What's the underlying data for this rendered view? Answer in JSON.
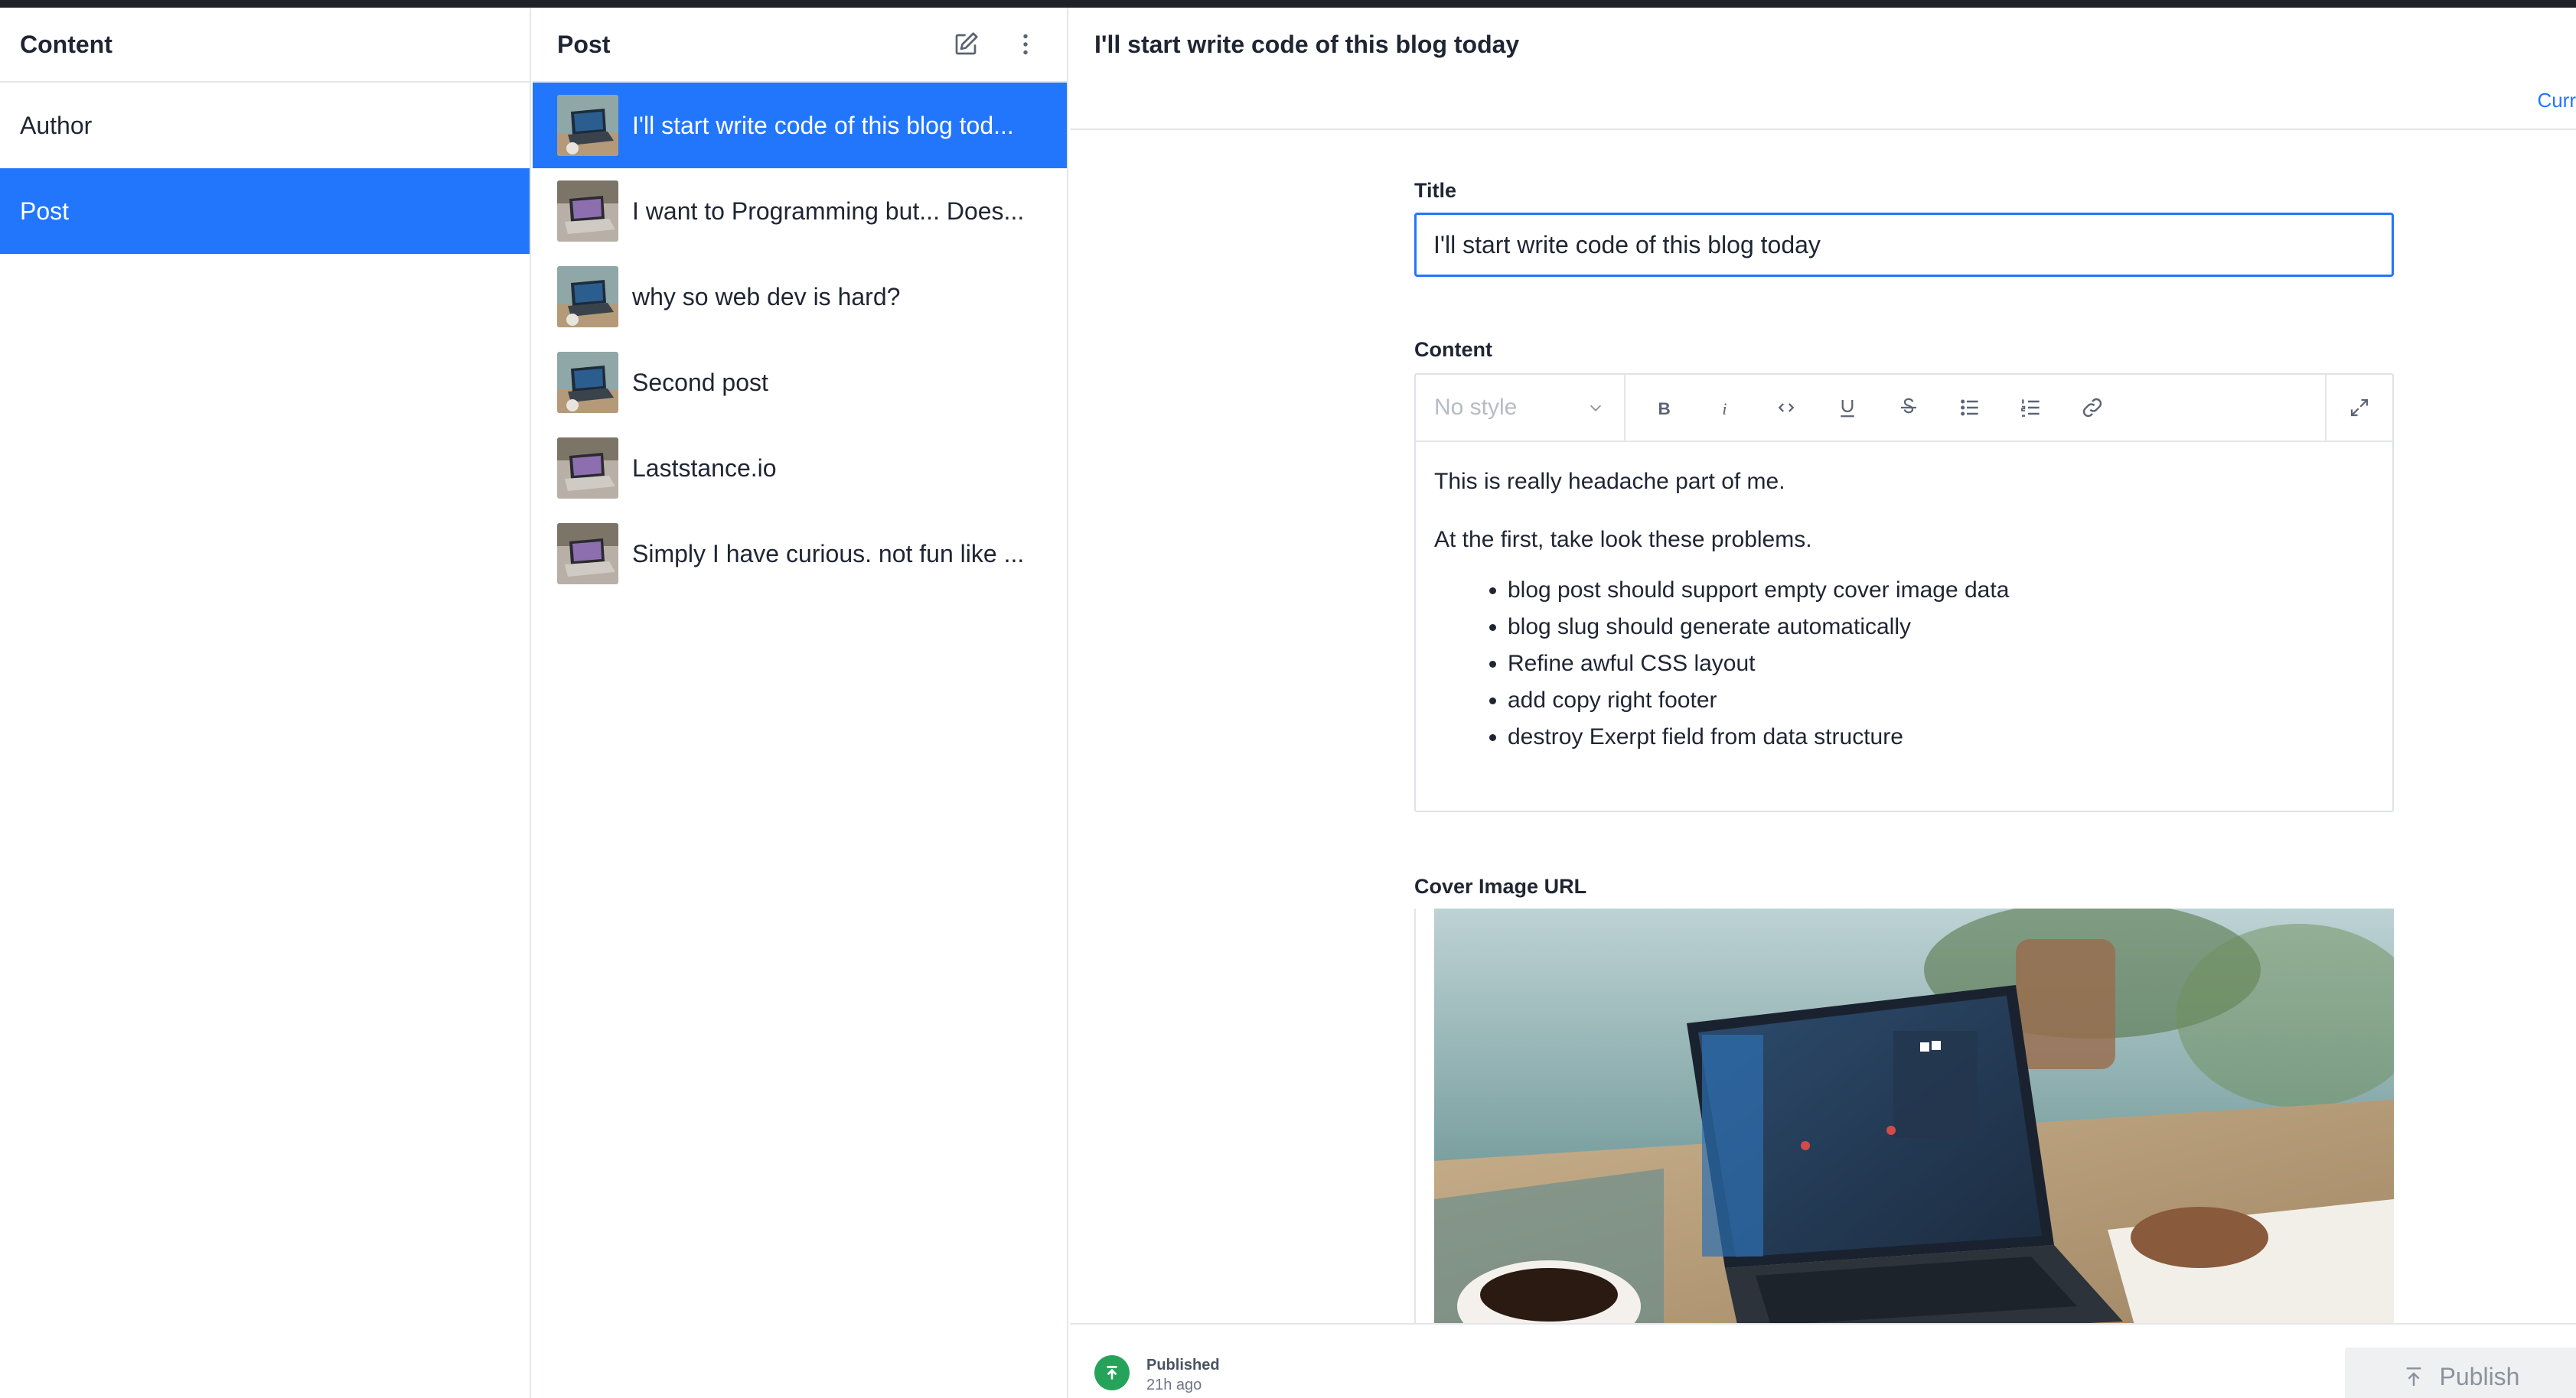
{
  "colors": {
    "accent": "#2276fc",
    "published": "#26a35a"
  },
  "content_pane": {
    "title": "Content",
    "items": [
      {
        "label": "Author",
        "selected": false
      },
      {
        "label": "Post",
        "selected": true
      }
    ]
  },
  "posts_pane": {
    "title": "Post",
    "actions": {
      "compose_icon": "compose-icon",
      "menu_icon": "more-vertical-icon"
    },
    "items": [
      {
        "title": "I'll start write code of this blog tod...",
        "selected": true
      },
      {
        "title": "I want to Programming but... Does...",
        "selected": false
      },
      {
        "title": "why so web dev is hard?",
        "selected": false
      },
      {
        "title": "Second post",
        "selected": false
      },
      {
        "title": "Laststance.io",
        "selected": false
      },
      {
        "title": "Simply I have curious. not fun like ...",
        "selected": false
      }
    ]
  },
  "editor": {
    "document_title": "I'll start write code of this blog today",
    "tab_current": "Curr",
    "title_field": {
      "label": "Title",
      "value": "I'll start write code of this blog today"
    },
    "content_field": {
      "label": "Content",
      "toolbar": {
        "style_select": "No style",
        "buttons": [
          "bold-icon",
          "italic-icon",
          "code-icon",
          "underline-icon",
          "strikethrough-icon",
          "bullet-list-icon",
          "numbered-list-icon",
          "link-icon"
        ],
        "expand": "expand-icon"
      },
      "paragraphs": [
        "This is really headache part of me.",
        "At the first, take look these problems."
      ],
      "bullets": [
        "blog post should support empty cover image data",
        "blog slug should generate automatically",
        "Refine awful CSS layout",
        "add copy right footer",
        "destroy Exerpt field from data structure"
      ]
    },
    "cover_field": {
      "label": "Cover Image URL"
    }
  },
  "footer": {
    "status": "Published",
    "time": "21h ago",
    "publish_label": "Publish"
  }
}
